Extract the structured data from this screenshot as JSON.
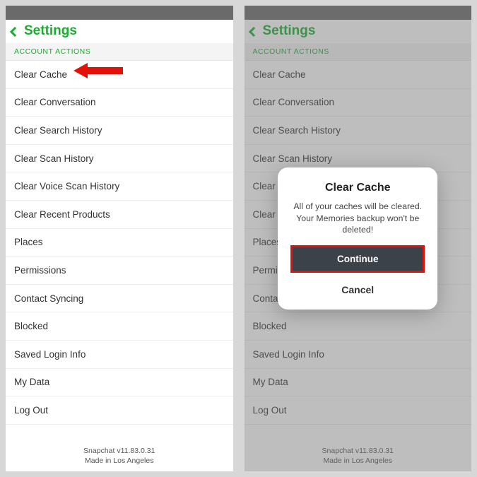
{
  "header": {
    "title": "Settings"
  },
  "section": {
    "label": "ACCOUNT ACTIONS"
  },
  "items": [
    "Clear Cache",
    "Clear Conversation",
    "Clear Search History",
    "Clear Scan History",
    "Clear Voice Scan History",
    "Clear Recent Products",
    "Places",
    "Permissions",
    "Contact Syncing",
    "Blocked",
    "Saved Login Info",
    "My Data",
    "Log Out"
  ],
  "footer": {
    "line1": "Snapchat v11.83.0.31",
    "line2": "Made in Los Angeles"
  },
  "modal": {
    "title": "Clear Cache",
    "message": "All of your caches will be cleared. Your Memories backup won't be deleted!",
    "primary": "Continue",
    "secondary": "Cancel"
  }
}
